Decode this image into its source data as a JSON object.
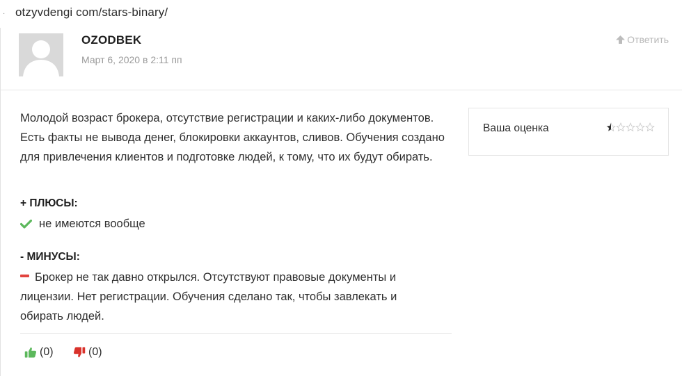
{
  "browser": {
    "url": "otzyvdengi com/stars-binary/"
  },
  "comment": {
    "author": "OZODBEK",
    "date": "Март 6, 2020 в 2:11 пп",
    "reply_label": "Ответить",
    "text": "Молодой возраст брокера, отсутствие регистрации и каких-либо документов. Есть факты не вывода денег, блокировки аккаунтов, сливов. Обучения создано для привлечения клиентов и подготовке людей, к тому, что их будут обирать.",
    "rating": {
      "label": "Ваша оценка",
      "value": 0.5,
      "max": 5,
      "star_color": "#c9c9c9",
      "filled_color": "#2b2b2b"
    },
    "pros": {
      "title": "+ ПЛЮСЫ:",
      "item": "не имеются вообще",
      "icon": "check-icon",
      "color": "#5cb85c"
    },
    "cons": {
      "title": "- МИНУСЫ:",
      "item": "Брокер не так давно открылся. Отсутствуют правовые документы и лицензии. Нет регистрации. Обучения сделано так, чтобы завлекать и обирать людей.",
      "icon": "minus-icon",
      "color": "#e2443f"
    },
    "votes": {
      "up_label": "(0)",
      "down_label": "(0)",
      "up_icon": "thumbs-up-icon",
      "down_icon": "thumbs-down-icon",
      "up_color": "#5cb85c",
      "down_color": "#d9322b"
    }
  }
}
